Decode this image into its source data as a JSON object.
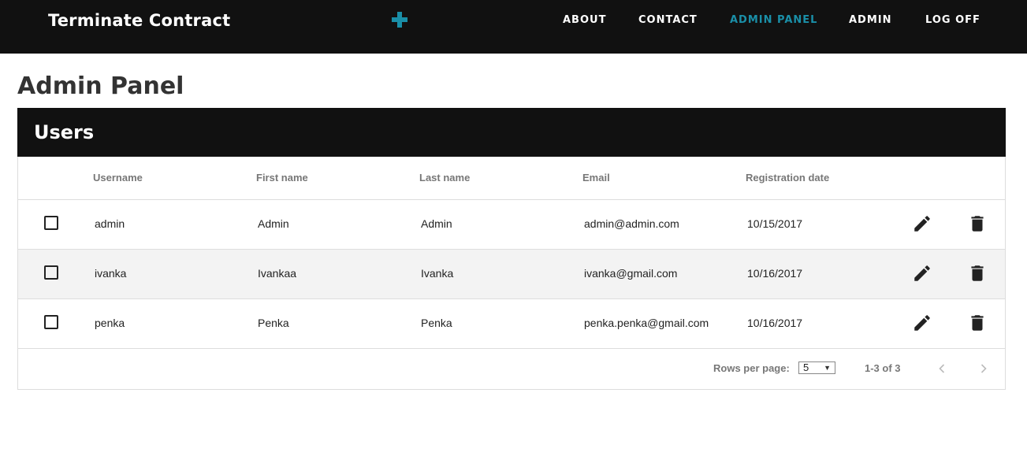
{
  "navbar": {
    "brand": "Terminate Contract",
    "plus_icon": "plus-icon",
    "links": [
      "ABOUT",
      "CONTACT",
      "ADMIN PANEL",
      "ADMIN",
      "LOG OFF"
    ],
    "active_link": "ADMIN PANEL",
    "accent_color": "#1a8fa8",
    "background": "#111111"
  },
  "page": {
    "title": "Admin Panel"
  },
  "users": {
    "title": "Users",
    "columns": [
      "Username",
      "First name",
      "Last name",
      "Email",
      "Registration date"
    ],
    "rows": [
      {
        "username": "admin",
        "first": "Admin",
        "last": "Admin",
        "email": "admin@admin.com",
        "date": "10/15/2017",
        "checked": false
      },
      {
        "username": "ivanka",
        "first": "Ivankaa",
        "last": "Ivanka",
        "email": "ivanka@gmail.com",
        "date": "10/16/2017",
        "checked": false
      },
      {
        "username": "penka",
        "first": "Penka",
        "last": "Penka",
        "email": "penka.penka@gmail.com",
        "date": "10/16/2017",
        "checked": false
      }
    ],
    "row_actions": [
      "pencil-icon",
      "trash-icon"
    ],
    "footer": {
      "rows_per_page_label": "Rows per page:",
      "rows_per_page_value": "5",
      "range_text": "1-3 of 3",
      "prev_icon": "chevron-left-icon",
      "next_icon": "chevron-right-icon"
    }
  }
}
